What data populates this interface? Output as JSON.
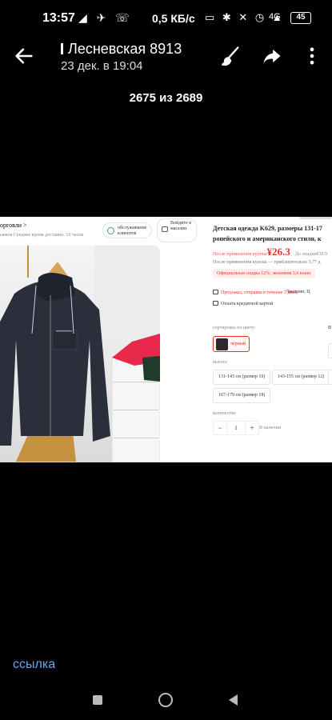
{
  "status_bar": {
    "time": "13:57",
    "notif_icons": "◢ ✈ ☏",
    "net_speed": "0,5 КБ/с",
    "sys_icons": "▭ ✱ ✕ ◷ ▲",
    "network": "4G",
    "battery": "45"
  },
  "header": {
    "title": "Лесневская 8913",
    "subtitle": "23 дек. в 19:04"
  },
  "counter": "2675 из 2689",
  "product_page": {
    "shop_link": "орговли >",
    "shop_meta": "ывков    Среднее время доставки: 19 часов",
    "service_button": "обслуживание клиентов",
    "login_button": "Войдите в магазин",
    "title": "Детская одежда K629, размеры 131-17",
    "title_line2": "ропейского и американского стиля, к",
    "price_prefix": "После применения купона",
    "price_currency": "¥",
    "price": "26.3",
    "price_orig": "До скидки¥39.9",
    "coupon_note": "После применения купона — приблизительно 3,77 д",
    "official_discount": "Официальная скидка 12%, экономия 3,6 юаня.",
    "shipping": "Предзаказ, отправка в течение 5 дней",
    "shipping_from": "Чжэцзян, Ц",
    "payment": "Оплата кредитной картой",
    "sort_label": "сортировка по цвету:",
    "sort_right": "В",
    "color": "черный",
    "height_label": "высота",
    "sizes": [
      "131-143 см (размер 10)",
      "143-155 см (размер 12)",
      "167-179 см (размер 18)"
    ],
    "qty_label": "количество",
    "qty_minus": "−",
    "qty_value": "1",
    "qty_plus": "+",
    "availability": "В наличии"
  },
  "link_text": "ссылка"
}
